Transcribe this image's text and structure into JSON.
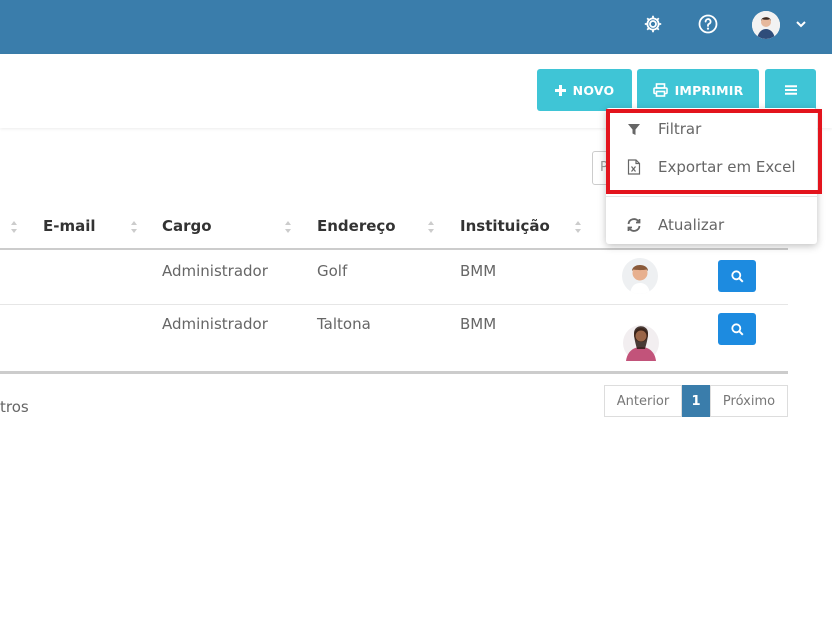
{
  "topbar": {
    "settings_icon": "gear-icon",
    "help_icon": "question-circle-icon",
    "user_menu_icon": "chevron-down-icon"
  },
  "toolbar": {
    "novo_label": "NOVO",
    "imprimir_label": "IMPRIMIR",
    "menu_icon": "hamburger-icon"
  },
  "search": {
    "placeholder": "P"
  },
  "dropdown": {
    "items": [
      {
        "label": "Filtrar",
        "icon": "filter-icon"
      },
      {
        "label": "Exportar em Excel",
        "icon": "excel-file-icon"
      },
      {
        "label": "Atualizar",
        "icon": "refresh-icon"
      }
    ]
  },
  "table": {
    "columns": [
      "E-mail",
      "Cargo",
      "Endereço",
      "Instituição"
    ],
    "rows": [
      {
        "email": "",
        "cargo": "Administrador",
        "endereco": "Golf",
        "instituicao": "BMM"
      },
      {
        "email": "",
        "cargo": "Administrador",
        "endereco": "Taltona",
        "instituicao": "BMM"
      }
    ]
  },
  "footer": {
    "info": "tros",
    "pagination": {
      "prev": "Anterior",
      "current": "1",
      "next": "Próximo"
    }
  },
  "colors": {
    "topbar": "#3a7dab",
    "button": "#3fc5d6",
    "view_button": "#1d8be0",
    "highlight": "#e3141d"
  }
}
